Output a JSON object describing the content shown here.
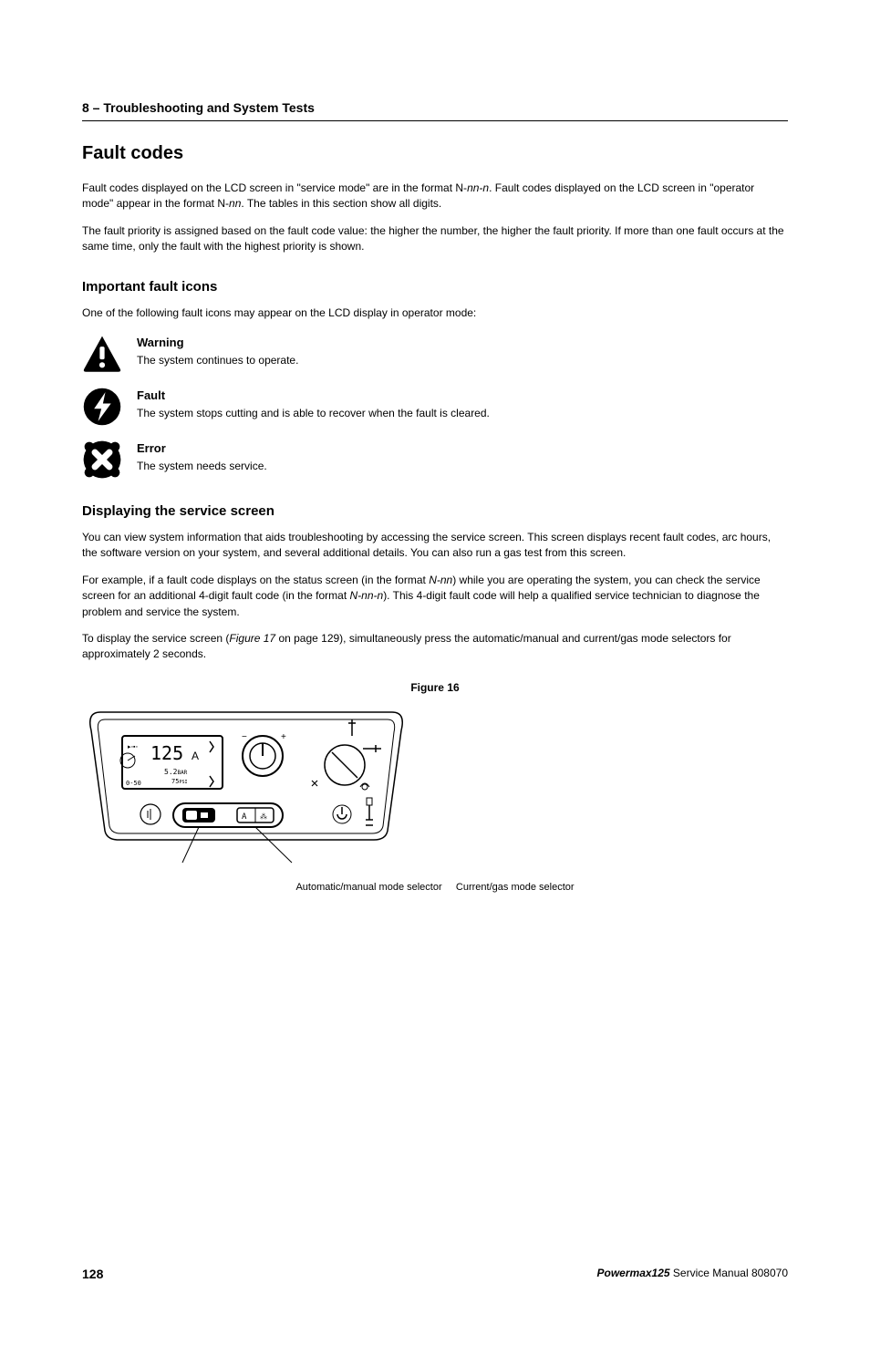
{
  "header": {
    "section": "8 – Troubleshooting and System Tests"
  },
  "h1": "Fault codes",
  "intro_p1_a": "Fault codes displayed on the LCD screen in \"service mode\" are in the format N-",
  "intro_p1_b": "nn-n",
  "intro_p1_c": ". Fault codes displayed on the LCD screen in \"operator mode\" appear in the format N-",
  "intro_p1_d": "nn",
  "intro_p1_e": ". The tables in this section show all digits.",
  "intro_p2": "The fault priority is assigned based on the fault code value: the higher the number, the higher the fault priority. If more than one fault occurs at the same time, only the fault with the highest priority is shown.",
  "h2_icons": "Important fault icons",
  "icons_intro": "One of the following fault icons may appear on the LCD display in operator mode:",
  "icons": {
    "warning": {
      "title": "Warning",
      "desc": "The system continues to operate."
    },
    "fault": {
      "title": "Fault",
      "desc": "The system stops cutting and is able to recover when the fault is cleared."
    },
    "error": {
      "title": "Error",
      "desc": "The system needs service."
    }
  },
  "h2_service": "Displaying the service screen",
  "service_p1": "You can view system information that aids troubleshooting by accessing the service screen. This screen displays recent fault codes, arc hours, the software version on your system, and several additional details. You can also run a gas test from this screen.",
  "service_p2_a": "For example, if a fault code displays on the status screen (in the format ",
  "service_p2_b": "N-nn",
  "service_p2_c": ") while you are operating the system, you can check the service screen for an additional 4-digit fault code (in the format ",
  "service_p2_d": "N-nn-n",
  "service_p2_e": "). This 4-digit fault code will help a qualified service technician to diagnose the problem and service the system.",
  "service_p3_a": "To display the service screen (",
  "service_p3_b": "Figure 17",
  "service_p3_c": " on page 129), simultaneously press the automatic/manual and current/gas mode selectors for approximately 2 seconds.",
  "figure": {
    "caption": "Figure 16",
    "label_left": "Automatic/manual mode selector",
    "label_right": "Current/gas mode selector",
    "lcd": {
      "amps": "125",
      "amps_unit": "A",
      "bar": "5.2",
      "bar_unit": "BAR",
      "psi": "75",
      "psi_unit": "PSI",
      "range": "0-50"
    }
  },
  "footer": {
    "page": "128",
    "product": "Powermax125",
    "tail": "  Service Manual  808070"
  }
}
